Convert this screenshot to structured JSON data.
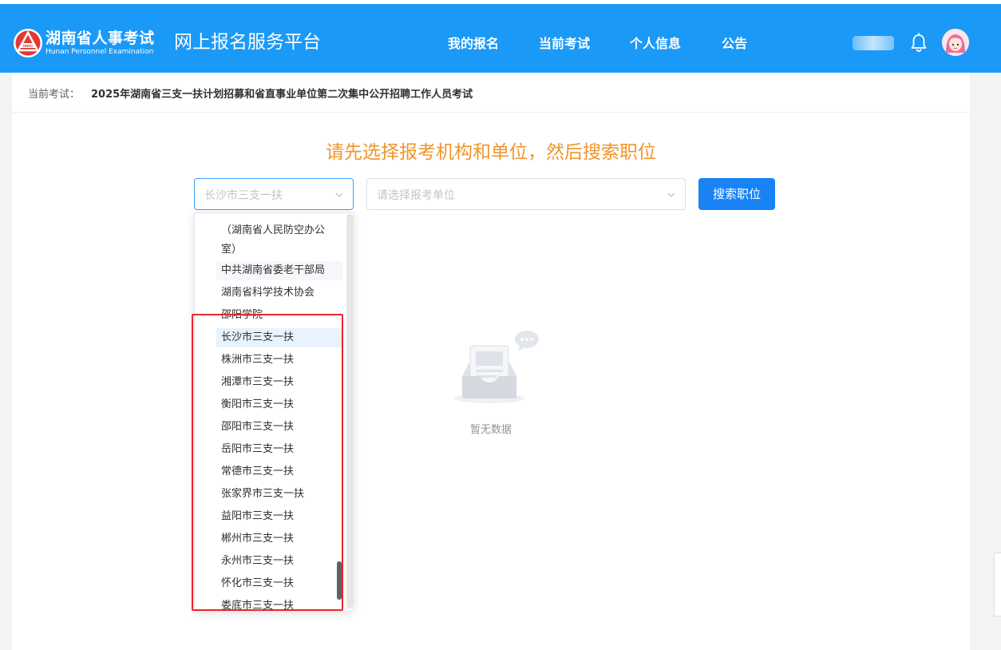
{
  "header": {
    "logo_cn": "湖南省人事考试",
    "logo_en": "Hunan Personnel Examination",
    "platform": "网上报名服务平台",
    "nav": [
      "我的报名",
      "当前考试",
      "个人信息",
      "公告"
    ],
    "brand_color": "#1b99f7"
  },
  "breadcrumb": {
    "label": "当前考试：",
    "value": "2025年湖南省三支一扶计划招募和省直事业单位第二次集中公开招聘工作人员考试"
  },
  "main": {
    "headline": "请先选择报考机构和单位，然后搜索职位",
    "org_select": {
      "value": "长沙市三支一扶"
    },
    "unit_select": {
      "placeholder": "请选择报考单位"
    },
    "search_button": "搜索职位",
    "empty_text": "暂无数据"
  },
  "dropdown": {
    "items": [
      "（湖南省人民防空办公室）",
      "中共湖南省委老干部局",
      "湖南省科学技术协会",
      "邵阳学院",
      "长沙市三支一扶",
      "株洲市三支一扶",
      "湘潭市三支一扶",
      "衡阳市三支一扶",
      "邵阳市三支一扶",
      "岳阳市三支一扶",
      "常德市三支一扶",
      "张家界市三支一扶",
      "益阳市三支一扶",
      "郴州市三支一扶",
      "永州市三支一扶",
      "怀化市三支一扶",
      "娄底市三支一扶"
    ],
    "selected_index": 4,
    "hover_index": 1
  },
  "icons": {
    "logo": "hnpe-emblem-icon",
    "bell": "bell-icon",
    "avatar": "avatar",
    "empty": "empty-inbox-icon"
  },
  "colors": {
    "highlight": "#e8262b",
    "headline": "#f0952b",
    "button": "#1983f6"
  }
}
